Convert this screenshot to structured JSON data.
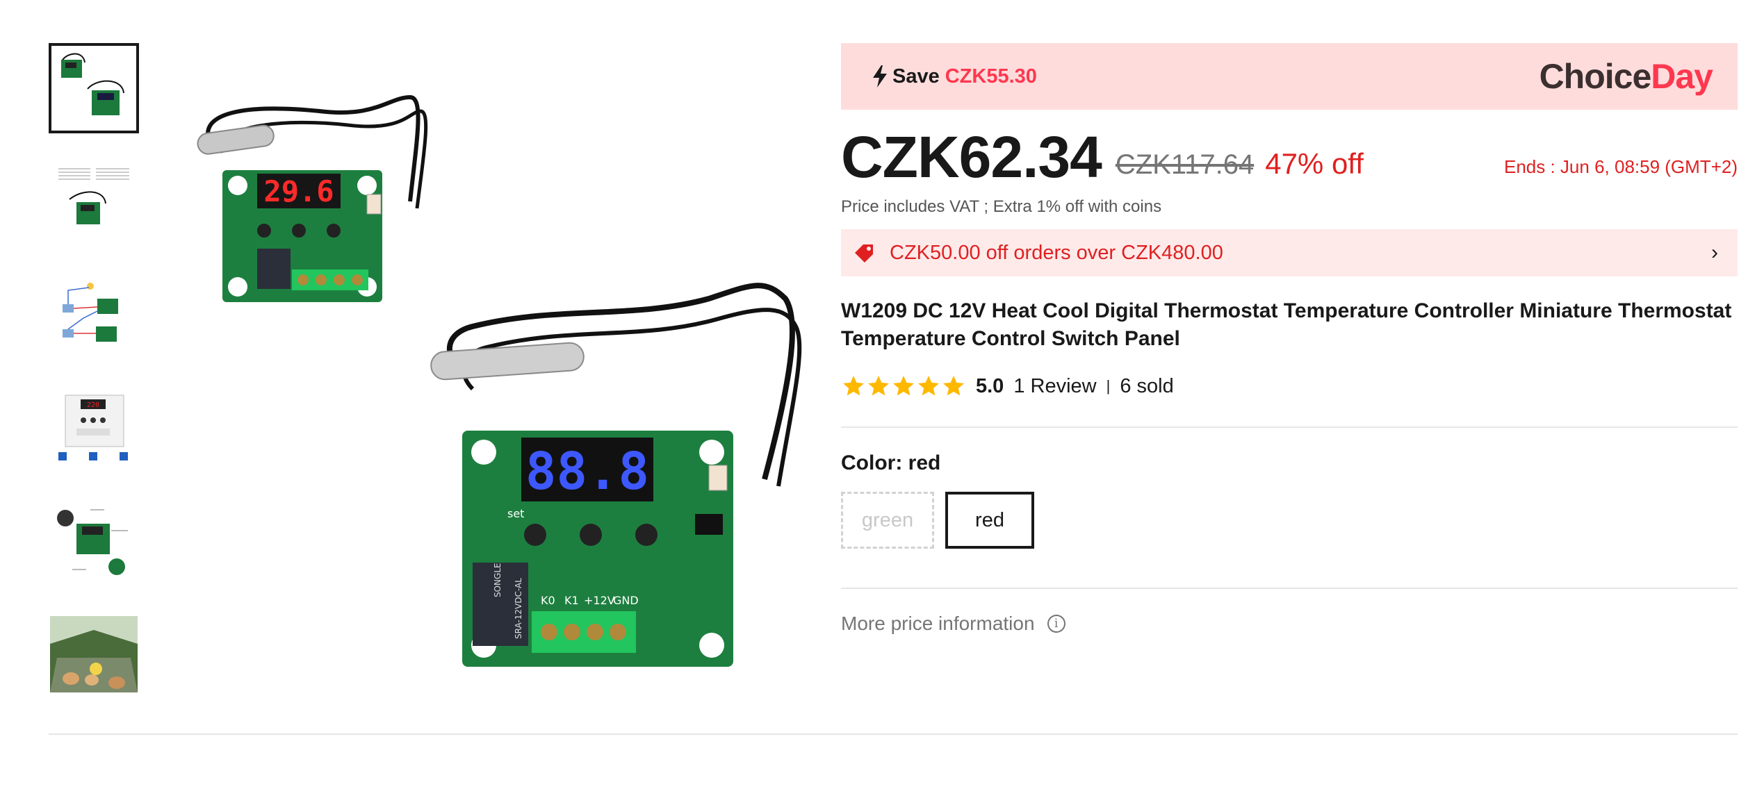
{
  "thumbnails": [
    {
      "name": "thumb-1",
      "icon": "product-pair-photo",
      "active": true
    },
    {
      "name": "thumb-2",
      "icon": "spec-sheet-photo",
      "active": false
    },
    {
      "name": "thumb-3",
      "icon": "wiring-diagram-photo",
      "active": false
    },
    {
      "name": "thumb-4",
      "icon": "panel-photo",
      "active": false
    },
    {
      "name": "thumb-5",
      "icon": "labeled-board-photo",
      "active": false
    },
    {
      "name": "thumb-6",
      "icon": "incubator-photo",
      "active": false
    }
  ],
  "main_image": {
    "board_small_display": "29.6",
    "board_large_display": "88.8",
    "labels": {
      "k0": "K0",
      "k1": "K1",
      "v12": "+12V",
      "gnd": "GND",
      "set": "set",
      "plus": "+",
      "minus": "-",
      "relay": "SRA-12VDC-AL",
      "relay_brand": "SONGLE"
    }
  },
  "promo": {
    "save_label": "Save",
    "save_amount": "CZK55.30",
    "brand_part1": "Choice",
    "brand_part2": "Day"
  },
  "price": {
    "current": "CZK62.34",
    "original": "CZK117.64",
    "discount": "47% off",
    "ends": "Ends :  Jun 6, 08:59 (GMT+2)",
    "vat_note": "Price includes VAT ; Extra 1% off with coins"
  },
  "coupon": {
    "text": "CZK50.00 off orders over CZK480.00"
  },
  "product": {
    "title": "W1209 DC 12V Heat Cool Digital Thermostat Temperature Controller Miniature Thermostat Temperature Control Switch Panel"
  },
  "rating": {
    "stars": 5,
    "score": "5.0",
    "reviews": "1 Review",
    "separator": "|",
    "sold": "6 sold"
  },
  "color": {
    "label": "Color: red",
    "options": [
      {
        "label": "green",
        "state": "disabled"
      },
      {
        "label": "red",
        "state": "selected"
      }
    ]
  },
  "more_info": {
    "label": "More price information"
  },
  "colors": {
    "accent_red": "#fd384f",
    "price_red": "#e02020",
    "promo_bg": "#ffdcdc",
    "coupon_bg": "#ffeaea",
    "star": "#ffb800"
  }
}
